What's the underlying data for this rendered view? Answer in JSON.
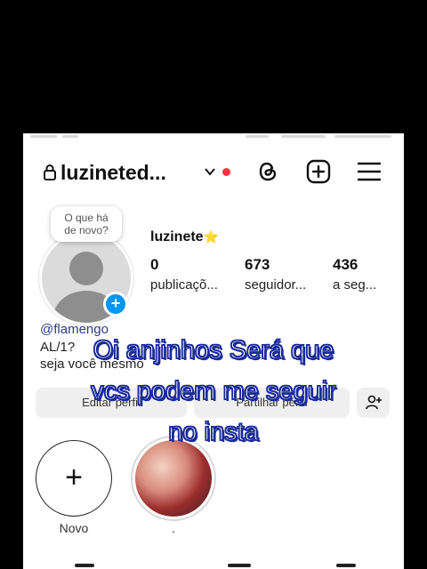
{
  "header": {
    "username": "luzineted...",
    "icons": [
      "lock-icon",
      "chevron-down-icon",
      "threads-icon",
      "plus-square-icon",
      "menu-icon"
    ]
  },
  "note": {
    "text_line1": "O que há",
    "text_line2": "de novo?"
  },
  "profile": {
    "display_name": "luzinete",
    "name_emoji": "⭐",
    "stats": [
      {
        "value": "0",
        "label": "publicaçõ..."
      },
      {
        "value": "673",
        "label": "seguidor..."
      },
      {
        "value": "436",
        "label": "a seg..."
      }
    ],
    "bio": [
      "@flamengo",
      "AL/1?",
      "seja você mesmo"
    ]
  },
  "buttons": {
    "edit": "Editar perfil",
    "share": "Partilhar perfil"
  },
  "caption": {
    "line1": "Oi anjinhos Será que",
    "line2": "vcs podem me seguir",
    "line3": "no insta"
  },
  "highlights": [
    {
      "label": "Novo",
      "icon": "plus-icon"
    },
    {
      "label": "."
    }
  ],
  "colors": {
    "accent": "#0095f6",
    "notification": "#ff3040",
    "caption_outline": "#1a2a9a"
  }
}
